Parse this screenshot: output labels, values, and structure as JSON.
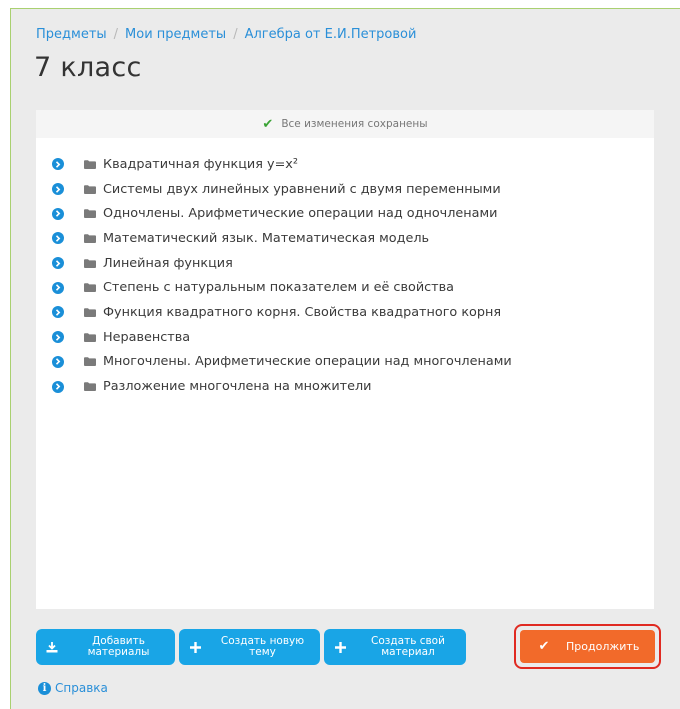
{
  "breadcrumb": {
    "items": [
      "Предметы",
      "Мои предметы",
      "Алгебра от Е.И.Петровой"
    ]
  },
  "page_title": "7 класс",
  "status": {
    "saved_text": "Все изменения сохранены",
    "check_color": "#3aa335"
  },
  "topics": [
    "Квадратичная функция y=x²",
    "Системы двух линейных уравнений с двумя переменными",
    "Одночлены. Арифметические операции над одночленами",
    "Математический язык. Математическая модель",
    "Линейная функция",
    "Степень с натуральным показателем и её свойства",
    "Функция квадратного корня. Свойства квадратного корня",
    "Неравенства",
    "Многочлены. Арифметические операции над многочленами",
    "Разложение многочлена на множители"
  ],
  "toolbar": {
    "add_materials": [
      "Добавить",
      "материалы"
    ],
    "create_topic": [
      "Создать новую",
      "тему"
    ],
    "create_material": [
      "Создать свой",
      "материал"
    ],
    "continue_label": "Продолжить"
  },
  "help": {
    "label": "Справка"
  },
  "colors": {
    "accent_blue": "#19a5e6",
    "continue_orange": "#f26a2a",
    "highlight_red": "#e02a21"
  }
}
